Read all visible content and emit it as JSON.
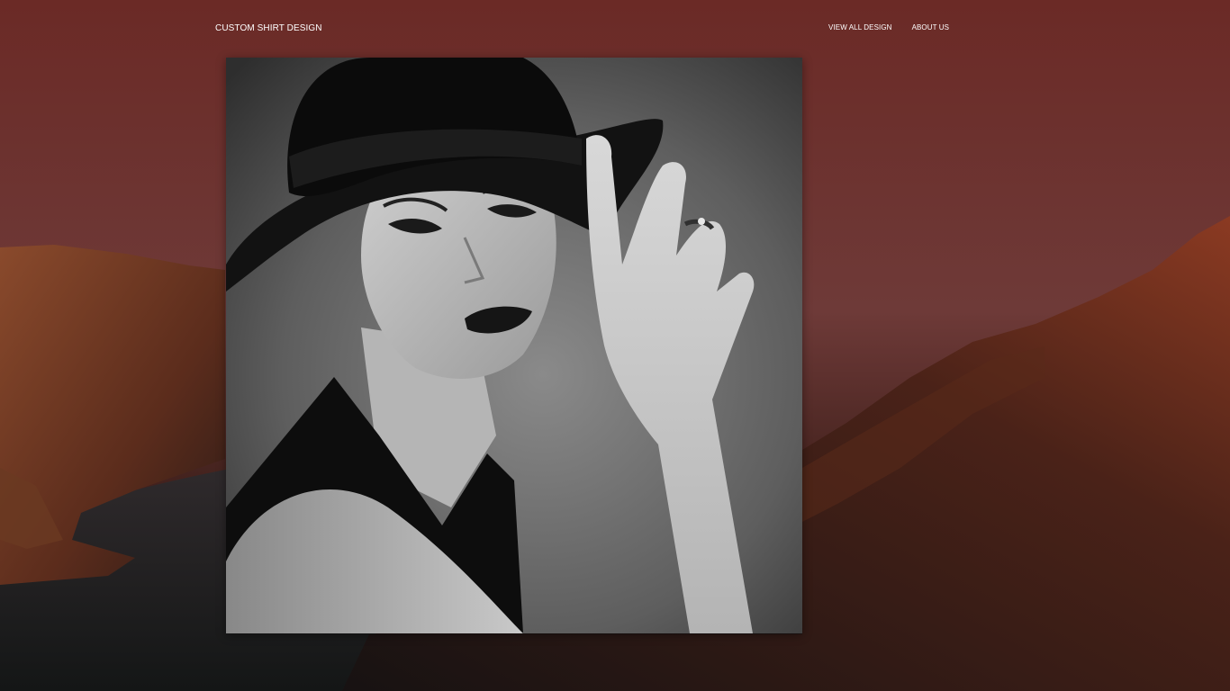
{
  "header": {
    "brand": "CUSTOM SHIRT DESIGN",
    "nav": [
      {
        "label": "VIEW ALL DESIGN"
      },
      {
        "label": "ABOUT US"
      }
    ]
  },
  "colors": {
    "background_top": "#6b2a26",
    "background_bottom": "#121010",
    "text": "#ffffff"
  },
  "hero": {
    "image": "black-and-white portrait photo"
  }
}
